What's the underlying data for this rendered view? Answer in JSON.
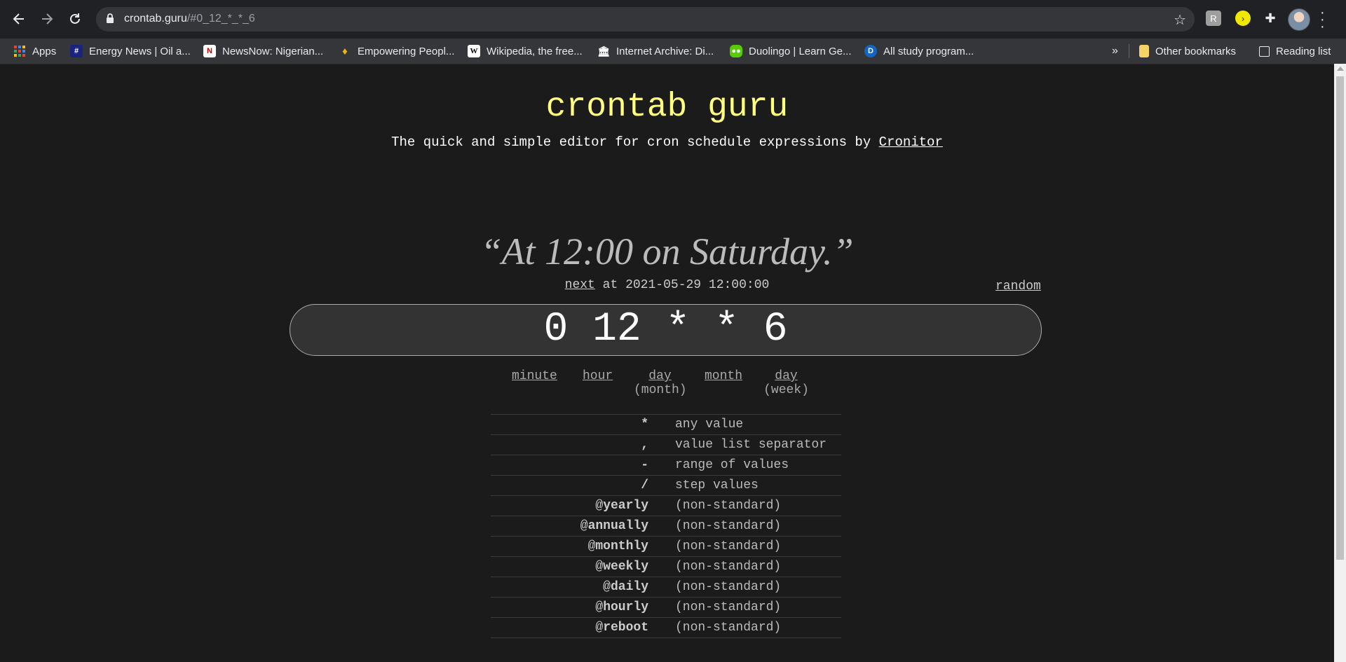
{
  "browser": {
    "url_host": "crontab.guru",
    "url_path": "/#0_12_*_*_6"
  },
  "bookmarks": [
    {
      "label": "Apps",
      "icon": "apps-grid-icon"
    },
    {
      "label": "Energy News | Oil a...",
      "icon": "energy-news-icon"
    },
    {
      "label": "NewsNow: Nigerian...",
      "icon": "newsnow-icon"
    },
    {
      "label": "Empowering Peopl...",
      "icon": "flame-icon"
    },
    {
      "label": "Wikipedia, the free...",
      "icon": "wikipedia-icon"
    },
    {
      "label": "Internet Archive: Di...",
      "icon": "archive-icon"
    },
    {
      "label": "Duolingo | Learn Ge...",
      "icon": "duolingo-icon"
    },
    {
      "label": "All study program...",
      "icon": "d-icon"
    }
  ],
  "bookmarks_overflow": "»",
  "other_bookmarks": "Other bookmarks",
  "reading_list": "Reading list",
  "page": {
    "title": "crontab guru",
    "subtitle_text": "The quick and simple editor for cron schedule expressions by ",
    "subtitle_link": "Cronitor",
    "human_readable": "“At 12:00 on Saturday.”",
    "next_link": "next",
    "next_text": " at 2021-05-29 12:00:00",
    "random_link": "random",
    "expression": "0 12 * * 6",
    "parts": [
      {
        "label": "minute",
        "sub": ""
      },
      {
        "label": "hour",
        "sub": ""
      },
      {
        "label": "day",
        "sub": "(month)"
      },
      {
        "label": "month",
        "sub": ""
      },
      {
        "label": "day",
        "sub": "(week)"
      }
    ],
    "legend": [
      {
        "at": "",
        "sym": "*",
        "desc": "any value"
      },
      {
        "at": "",
        "sym": ",",
        "desc": "value list separator"
      },
      {
        "at": "",
        "sym": "-",
        "desc": "range of values"
      },
      {
        "at": "",
        "sym": "/",
        "desc": "step values"
      },
      {
        "at": "@",
        "sym": "yearly",
        "desc": "(non-standard)"
      },
      {
        "at": "@",
        "sym": "annually",
        "desc": "(non-standard)"
      },
      {
        "at": "@",
        "sym": "monthly",
        "desc": "(non-standard)"
      },
      {
        "at": "@",
        "sym": "weekly",
        "desc": "(non-standard)"
      },
      {
        "at": "@",
        "sym": "daily",
        "desc": "(non-standard)"
      },
      {
        "at": "@",
        "sym": "hourly",
        "desc": "(non-standard)"
      },
      {
        "at": "@",
        "sym": "reboot",
        "desc": "(non-standard)"
      }
    ]
  },
  "colors": {
    "background": "#1b1b1b",
    "title": "#ffff80",
    "input_bg": "#333333"
  }
}
